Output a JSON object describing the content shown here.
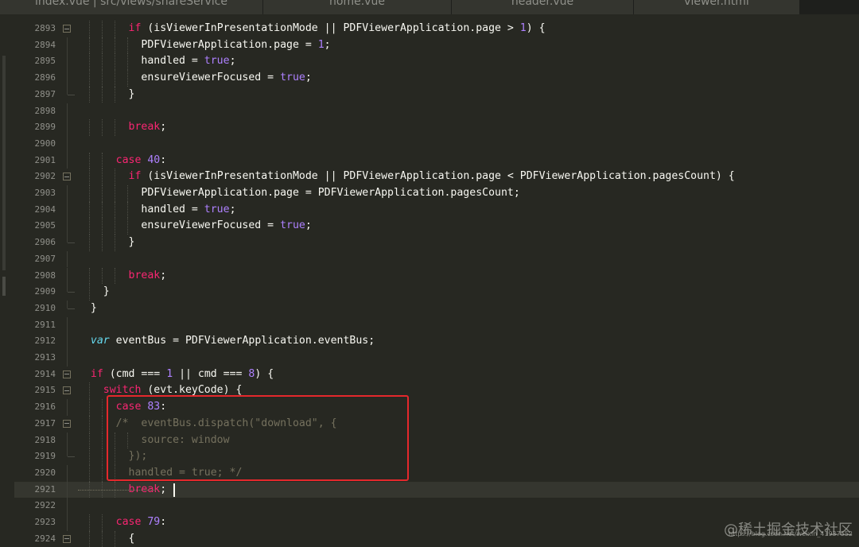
{
  "tabs": [
    {
      "label": "index.vue | src/views/shareService"
    },
    {
      "label": "home.vue"
    },
    {
      "label": "header.vue"
    },
    {
      "label": "viewer.html"
    }
  ],
  "lines": [
    {
      "n": "2893",
      "fold": "open",
      "segments": [
        {
          "t": "        "
        },
        {
          "c": "kw",
          "t": "if"
        },
        {
          "t": " (isViewerInPresentationMode || PDFViewerApplication.page > "
        },
        {
          "c": "num",
          "t": "1"
        },
        {
          "t": ") {"
        }
      ]
    },
    {
      "n": "2894",
      "fold": "bar",
      "segments": [
        {
          "t": "          PDFViewerApplication.page = "
        },
        {
          "c": "num",
          "t": "1"
        },
        {
          "t": ";"
        }
      ]
    },
    {
      "n": "2895",
      "fold": "bar",
      "segments": [
        {
          "t": "          handled = "
        },
        {
          "c": "num",
          "t": "true"
        },
        {
          "t": ";"
        }
      ]
    },
    {
      "n": "2896",
      "fold": "bar",
      "segments": [
        {
          "t": "          ensureViewerFocused = "
        },
        {
          "c": "num",
          "t": "true"
        },
        {
          "t": ";"
        }
      ]
    },
    {
      "n": "2897",
      "fold": "end",
      "segments": [
        {
          "t": "        }"
        }
      ]
    },
    {
      "n": "2898",
      "fold": "bar",
      "segments": []
    },
    {
      "n": "2899",
      "fold": "bar",
      "segments": [
        {
          "t": "        "
        },
        {
          "c": "kw",
          "t": "break"
        },
        {
          "t": ";"
        }
      ]
    },
    {
      "n": "2900",
      "fold": "bar",
      "segments": []
    },
    {
      "n": "2901",
      "fold": "bar",
      "segments": [
        {
          "t": "      "
        },
        {
          "c": "kw",
          "t": "case"
        },
        {
          "t": " "
        },
        {
          "c": "num",
          "t": "40"
        },
        {
          "t": ":"
        }
      ]
    },
    {
      "n": "2902",
      "fold": "open",
      "segments": [
        {
          "t": "        "
        },
        {
          "c": "kw",
          "t": "if"
        },
        {
          "t": " (isViewerInPresentationMode || PDFViewerApplication.page < PDFViewerApplication.pagesCount) {"
        }
      ]
    },
    {
      "n": "2903",
      "fold": "bar",
      "segments": [
        {
          "t": "          PDFViewerApplication.page = PDFViewerApplication.pagesCount;"
        }
      ]
    },
    {
      "n": "2904",
      "fold": "bar",
      "segments": [
        {
          "t": "          handled = "
        },
        {
          "c": "num",
          "t": "true"
        },
        {
          "t": ";"
        }
      ]
    },
    {
      "n": "2905",
      "fold": "bar",
      "segments": [
        {
          "t": "          ensureViewerFocused = "
        },
        {
          "c": "num",
          "t": "true"
        },
        {
          "t": ";"
        }
      ]
    },
    {
      "n": "2906",
      "fold": "end",
      "segments": [
        {
          "t": "        }"
        }
      ]
    },
    {
      "n": "2907",
      "fold": "bar",
      "segments": []
    },
    {
      "n": "2908",
      "fold": "bar",
      "segments": [
        {
          "t": "        "
        },
        {
          "c": "kw",
          "t": "break"
        },
        {
          "t": ";"
        }
      ]
    },
    {
      "n": "2909",
      "fold": "end",
      "segments": [
        {
          "t": "    }"
        }
      ]
    },
    {
      "n": "2910",
      "fold": "end",
      "segments": [
        {
          "t": "  }"
        }
      ]
    },
    {
      "n": "2911",
      "fold": "bar",
      "segments": []
    },
    {
      "n": "2912",
      "fold": "bar",
      "segments": [
        {
          "t": "  "
        },
        {
          "c": "sto",
          "t": "var"
        },
        {
          "t": " eventBus = PDFViewerApplication.eventBus;"
        }
      ]
    },
    {
      "n": "2913",
      "fold": "bar",
      "segments": []
    },
    {
      "n": "2914",
      "fold": "open",
      "segments": [
        {
          "t": "  "
        },
        {
          "c": "kw",
          "t": "if"
        },
        {
          "t": " (cmd === "
        },
        {
          "c": "num",
          "t": "1"
        },
        {
          "t": " || cmd === "
        },
        {
          "c": "num",
          "t": "8"
        },
        {
          "t": ") {"
        }
      ]
    },
    {
      "n": "2915",
      "fold": "open",
      "segments": [
        {
          "t": "    "
        },
        {
          "c": "kw",
          "t": "switch"
        },
        {
          "t": " (evt.keyCode) {"
        }
      ]
    },
    {
      "n": "2916",
      "fold": "bar",
      "segments": [
        {
          "t": "      "
        },
        {
          "c": "kw",
          "t": "case"
        },
        {
          "t": " "
        },
        {
          "c": "num",
          "t": "83"
        },
        {
          "t": ":"
        }
      ]
    },
    {
      "n": "2917",
      "fold": "open",
      "segments": [
        {
          "t": "      "
        },
        {
          "c": "cmt",
          "t": "/*  eventBus.dispatch(\"download\", {"
        }
      ]
    },
    {
      "n": "2918",
      "fold": "bar",
      "segments": [
        {
          "c": "cmt",
          "t": "          source: window"
        }
      ]
    },
    {
      "n": "2919",
      "fold": "end",
      "segments": [
        {
          "c": "cmt",
          "t": "        });"
        }
      ]
    },
    {
      "n": "2920",
      "fold": "bar",
      "segments": [
        {
          "c": "cmt",
          "t": "        handled = true; */"
        }
      ]
    },
    {
      "n": "2921",
      "fold": "bar",
      "current": true,
      "segments": [
        {
          "t": "        "
        },
        {
          "c": "kw",
          "t": "break"
        },
        {
          "t": ";"
        }
      ]
    },
    {
      "n": "2922",
      "fold": "bar",
      "segments": []
    },
    {
      "n": "2923",
      "fold": "bar",
      "segments": [
        {
          "t": "      "
        },
        {
          "c": "kw",
          "t": "case"
        },
        {
          "t": " "
        },
        {
          "c": "num",
          "t": "79"
        },
        {
          "t": ":"
        }
      ]
    },
    {
      "n": "2924",
      "fold": "open",
      "segments": [
        {
          "t": "        {"
        }
      ]
    }
  ],
  "watermark": {
    "main": "@稀土掘金技术社区",
    "sub": "https://blog.csdn.net/weixin_41937552"
  },
  "colors": {
    "background": "#272822",
    "keyword": "#f92672",
    "number": "#ae81ff",
    "comment": "#75715e",
    "highlight_box": "#e5282c"
  }
}
